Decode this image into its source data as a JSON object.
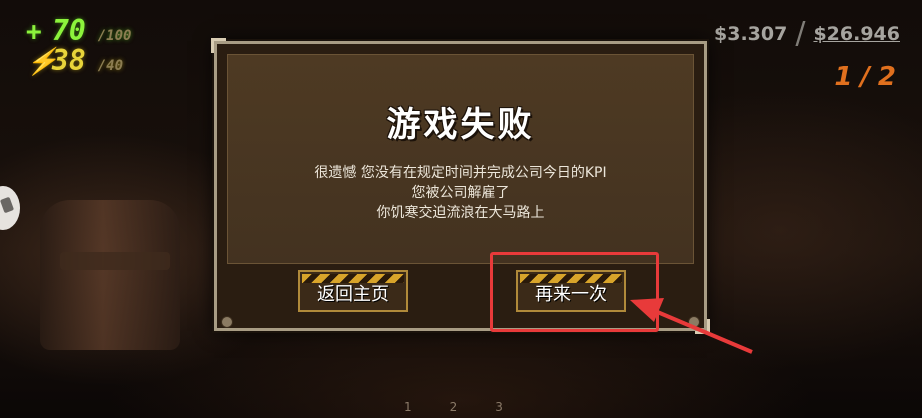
{
  "hud": {
    "health": {
      "icon": "+",
      "value": "70",
      "max": "/100"
    },
    "energy": {
      "icon": "⚡",
      "value": "38",
      "max": "/40"
    },
    "money": {
      "current": "$3.307",
      "separator": "/",
      "target": "$26.946"
    },
    "progress": "1/2"
  },
  "dialog": {
    "title": "游戏失败",
    "message_lines": [
      "很遗憾 您没有在规定时间并完成公司今日的KPI",
      "您被公司解雇了",
      "你饥寒交迫流浪在大马路上"
    ],
    "buttons": {
      "home": "返回主页",
      "retry": "再来一次"
    }
  },
  "pager": [
    "1",
    "2",
    "3"
  ],
  "colors": {
    "health": "#8cf33c",
    "energy": "#e8d43a",
    "progress": "#e0701e",
    "annotation": "#e83a3a"
  }
}
